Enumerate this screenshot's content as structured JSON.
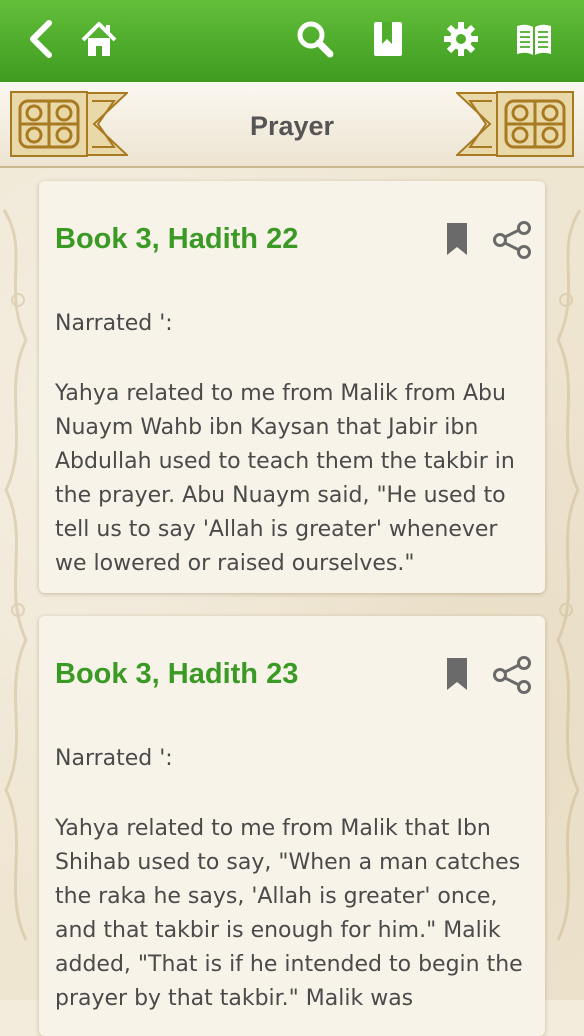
{
  "toolbar": {
    "icons": [
      "back-icon",
      "home-icon",
      "search-icon",
      "bookmark-icon",
      "gear-icon",
      "book-icon"
    ]
  },
  "header": {
    "title": "Prayer"
  },
  "hadiths": [
    {
      "title": "Book 3, Hadith 22",
      "narrated": "Narrated ':",
      "text": "Yahya related to me from Malik from Abu Nuaym Wahb ibn Kaysan that Jabir ibn Abdullah used to teach them the takbir in the prayer. Abu Nuaym said, \"He used to tell us to say 'Allah is greater' whenever we lowered or raised ourselves.\""
    },
    {
      "title": "Book 3, Hadith 23",
      "narrated": "Narrated ':",
      "text": "Yahya related to me from Malik that Ibn Shihab used to say, \"When a man catches the raka he says, 'Allah is greater' once, and that takbir is enough for him.\" Malik added, \"That is if he intended to begin the prayer by that takbir.\" Malik was"
    }
  ],
  "colors": {
    "toolbar_green": "#4fae2b",
    "title_green": "#3a9a25",
    "text_gray": "#4a4a4a",
    "icon_gray": "#666666",
    "ornament_gold": "#b88a2e"
  }
}
